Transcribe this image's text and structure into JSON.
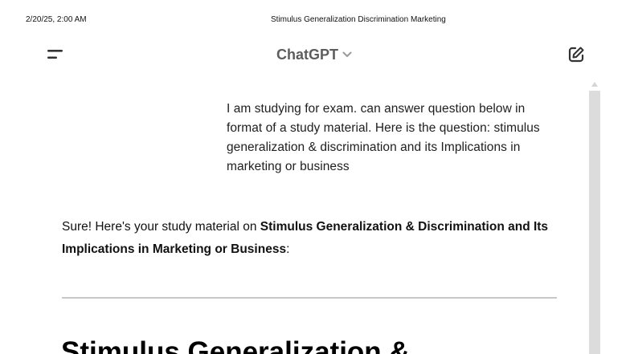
{
  "print_header": {
    "date": "2/20/25, 2:00 AM",
    "title": "Stimulus Generalization Discrimination Marketing"
  },
  "topbar": {
    "model_name": "ChatGPT",
    "menu_icon": "sidebar-menu-icon",
    "dropdown_icon": "chevron-down-icon",
    "new_chat_icon": "compose-icon"
  },
  "conversation": {
    "user_message": "I am studying for exam. can answer question below in format of a study material. Here is the question: stimulus generalization & discrimination and its Implications in marketing or business",
    "assistant": {
      "intro_prefix": "Sure! Here's your study material on ",
      "intro_bold": "Stimulus Generalization & Discrimination and Its Implications in Marketing or Business",
      "intro_suffix": ":",
      "heading": "Stimulus Generalization &"
    }
  },
  "colors": {
    "model_name": "#5d5d5d",
    "divider": "#c8c8c8",
    "scrollbar": "#e9e9e9"
  }
}
